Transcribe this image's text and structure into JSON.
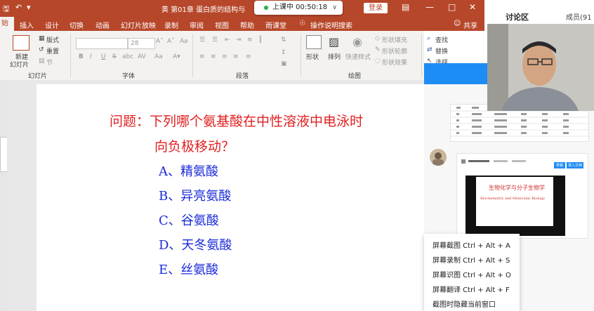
{
  "titlebar": {
    "doc_title": "黄 第01章 蛋白质的结构与功能[兼容",
    "login_label": "登录",
    "minimize_icon": "minimize-icon",
    "maximize_icon": "maximize-icon",
    "close_icon": "close-icon"
  },
  "timer": {
    "label": "上课中 00:50:18"
  },
  "menu": {
    "tabs": [
      "始",
      "插入",
      "设计",
      "切换",
      "动画",
      "幻灯片放映",
      "录制",
      "审阅",
      "视图",
      "帮助",
      "雨课堂"
    ],
    "search_hint": "操作说明搜索",
    "share_label": "共享"
  },
  "ribbon": {
    "slides": {
      "new_slide_line1": "新建",
      "new_slide_line2": "幻灯片",
      "layout": "版式",
      "reset": "重置",
      "section": "节",
      "group": "幻灯片"
    },
    "font": {
      "size_value": "28",
      "bold": "B",
      "italic": "I",
      "underline": "U",
      "strike": "S",
      "shadow": "abc",
      "spacing": "AV",
      "case": "Aa",
      "group": "字体"
    },
    "paragraph": {
      "group": "段落"
    },
    "drawing": {
      "shapes": "形状",
      "arrange": "排列",
      "quick_styles": "快速样式",
      "fill": "形状填充",
      "outline": "形状轮廓",
      "effects": "形状效果",
      "group": "绘图"
    },
    "editing": {
      "find": "查找",
      "replace": "替换",
      "select": "选择"
    }
  },
  "slide": {
    "question_line1": "问题：下列哪个氨基酸在中性溶液中电泳时",
    "question_line2": "向负极移动？",
    "options": [
      "A、精氨酸",
      "B、异亮氨酸",
      "C、谷氨酸",
      "D、天冬氨酸",
      "E、丝氨酸"
    ]
  },
  "right_panel": {
    "cam_top_text": "讨论区",
    "cam_top_right": "成员(91",
    "video_title_cn": "生物化学与分子生物学",
    "video_title_en": "Biochemistry and Molecular Biology",
    "video_button_1": "草稿",
    "video_button_2": "录入文档"
  },
  "context_menu": {
    "items": [
      "屏幕截图 Ctrl + Alt + A",
      "屏幕录制 Ctrl + Alt + S",
      "屏幕识图 Ctrl + Alt + O",
      "屏幕翻译 Ctrl + Alt + F",
      "截图时隐藏当前窗口"
    ]
  },
  "colors": {
    "accent": "#b7472a",
    "question": "#e02020",
    "options": "#1a2ad8",
    "panel_blue": "#1e8cf5"
  }
}
